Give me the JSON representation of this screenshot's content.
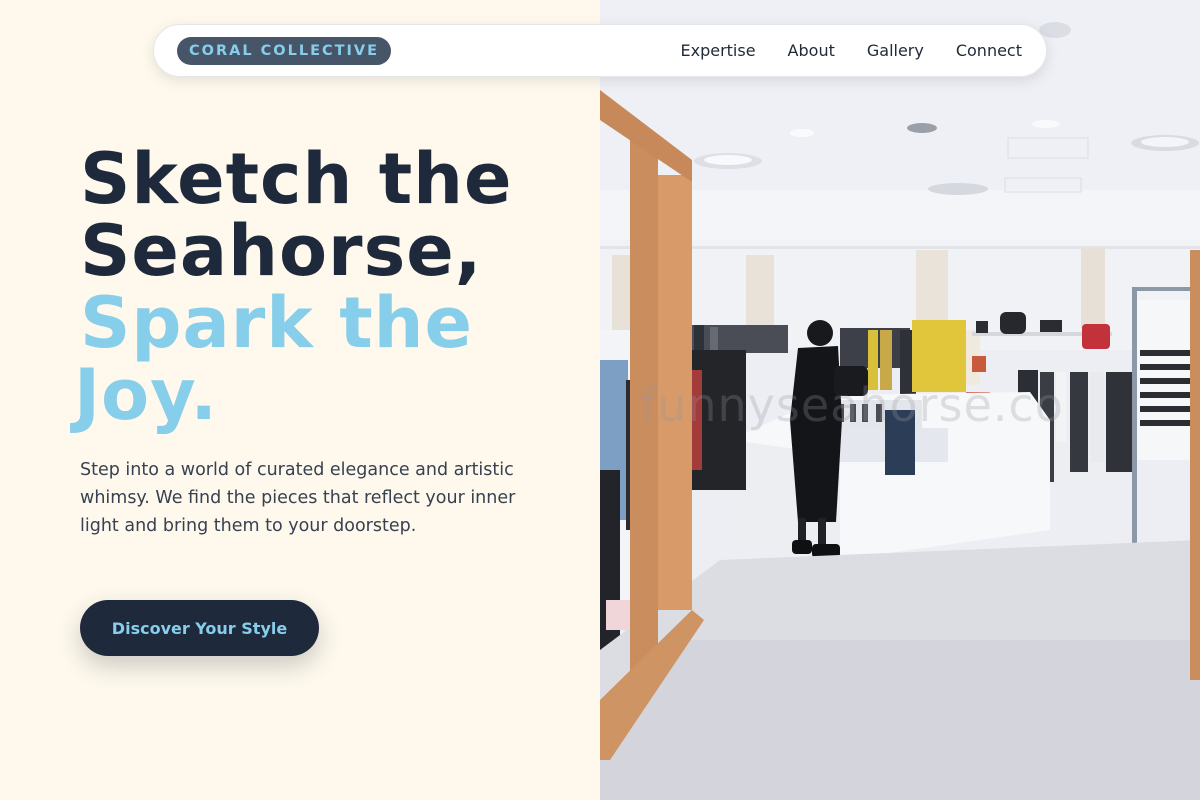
{
  "brand": {
    "name": "CORAL COLLECTIVE"
  },
  "nav": {
    "links": [
      "Expertise",
      "About",
      "Gallery",
      "Connect"
    ]
  },
  "hero": {
    "title_line1": "Sketch the",
    "title_line2": "Seahorse,",
    "title_line3": "Spark the",
    "title_line4": "Joy.",
    "description": "Step into a world of curated elegance and artistic whimsy. We find the pieces that reflect your inner light and bring them to your doorstep.",
    "cta_label": "Discover Your Style"
  },
  "photo": {
    "watermark": "funnyseahorse.co"
  },
  "colors": {
    "background": "#fef9ec",
    "navy": "#1e293b",
    "accent": "#87ceeb",
    "brand_badge": "#475569"
  }
}
